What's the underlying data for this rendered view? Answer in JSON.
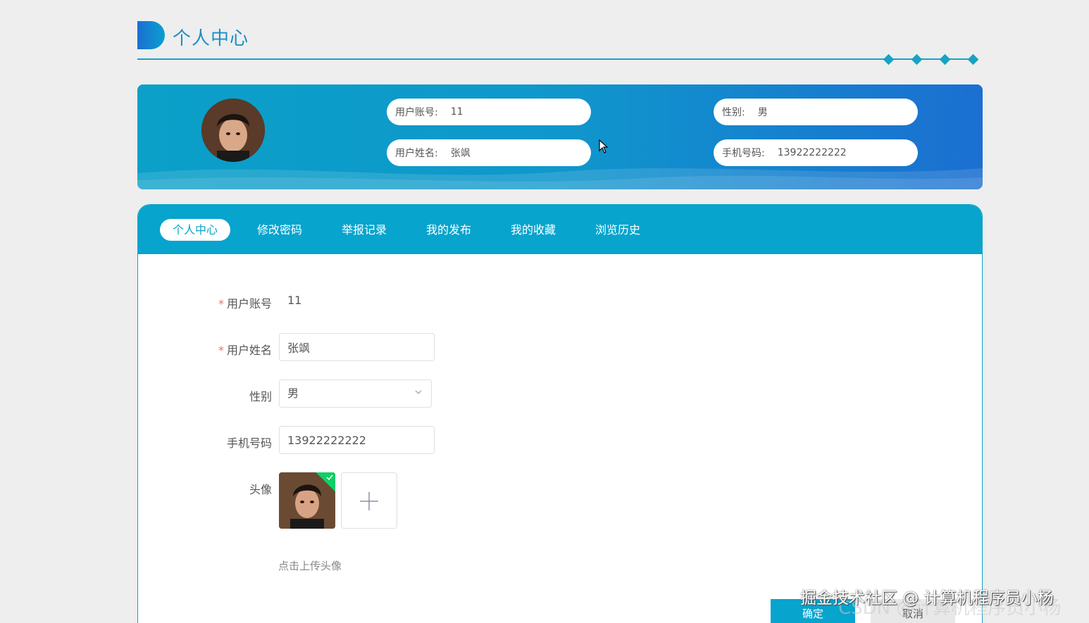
{
  "page_title": "个人中心",
  "colors": {
    "primary": "#07a4cd",
    "accent": "#1b6fd1",
    "required": "#f56c6c",
    "upload_ok": "#13ce66"
  },
  "banner": {
    "account_label": "用户账号:",
    "account_value": "11",
    "gender_label": "性别:",
    "gender_value": "男",
    "name_label": "用户姓名:",
    "name_value": "张飒",
    "phone_label": "手机号码:",
    "phone_value": "13922222222"
  },
  "tabs": [
    {
      "label": "个人中心",
      "active": true
    },
    {
      "label": "修改密码",
      "active": false
    },
    {
      "label": "举报记录",
      "active": false
    },
    {
      "label": "我的发布",
      "active": false
    },
    {
      "label": "我的收藏",
      "active": false
    },
    {
      "label": "浏览历史",
      "active": false
    }
  ],
  "form": {
    "account_label": "用户账号",
    "account_value": "11",
    "name_label": "用户姓名",
    "name_value": "张飒",
    "gender_label": "性别",
    "gender_value": "男",
    "phone_label": "手机号码",
    "phone_value": "13922222222",
    "avatar_label": "头像",
    "upload_hint": "点击上传头像"
  },
  "buttons": {
    "confirm": "确定",
    "cancel": "取消"
  },
  "watermark": {
    "line1": "掘金技术社区 @ 计算机程序员小杨",
    "line2": "CSDN @计算机程序员小杨"
  }
}
